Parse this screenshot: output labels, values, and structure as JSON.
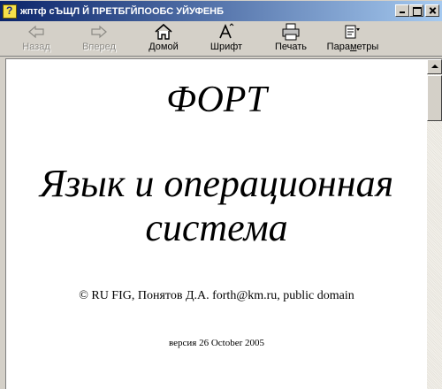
{
  "window": {
    "title": "жптф сЪЩЛ Й ПРЕТБГЙПООБС УЙУФЕНБ"
  },
  "toolbar": {
    "back_label": "Назад",
    "forward_label": "Вперед",
    "home_label": "Домой",
    "font_label": "Шрифт",
    "print_label": "Печать",
    "options_label_pre": "Пара",
    "options_label_mnemonic": "м",
    "options_label_post": "етры"
  },
  "document": {
    "title": "ФОРТ",
    "subtitle": "Язык и операционная система",
    "author": "© RU FIG, Понятов Д.А. forth@km.ru, public domain",
    "version": "версия 26 October 2005"
  },
  "icons": {
    "app": "help-file-icon",
    "back": "arrow-left-icon",
    "forward": "arrow-right-icon",
    "home": "house-icon",
    "font": "font-icon",
    "print": "printer-icon",
    "options": "options-icon"
  }
}
